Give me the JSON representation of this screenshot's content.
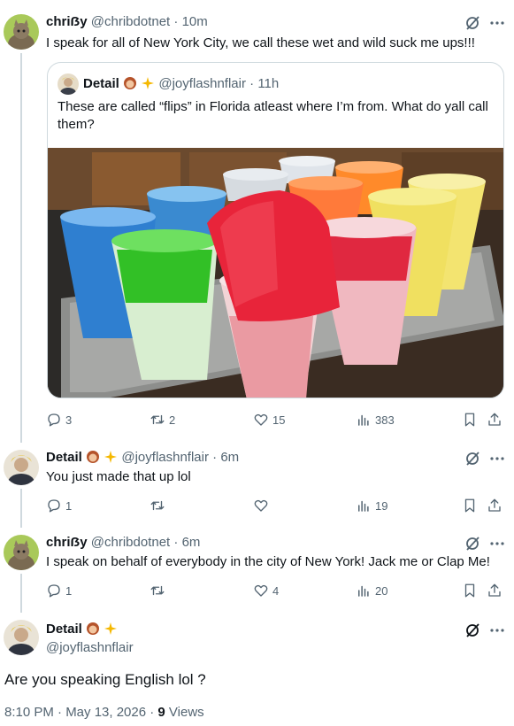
{
  "tweet1": {
    "name": "chriẞy",
    "handle": "@chribdotnet",
    "time": "10m",
    "text": "I speak for all of New York City, we call these wet and wild suck me ups!!!",
    "quote": {
      "name": "Detail",
      "handle": "@joyflashnflair",
      "time": "11h",
      "text": "These are called “flips” in Florida atleast where I’m from. What do yall call them?"
    },
    "replies": "3",
    "reposts": "2",
    "likes": "15",
    "views": "383"
  },
  "tweet2": {
    "name": "Detail",
    "handle": "@joyflashnflair",
    "time": "6m",
    "text": "You just made that up lol",
    "replies": "1",
    "reposts": "",
    "likes": "",
    "views": "19"
  },
  "tweet3": {
    "name": "chriẞy",
    "handle": "@chribdotnet",
    "time": "6m",
    "text": "I speak on behalf of everybody in the city of New York! Jack me or Clap Me!",
    "replies": "1",
    "reposts": "",
    "likes": "4",
    "views": "20"
  },
  "main": {
    "name": "Detail",
    "handle": "@joyflashnflair",
    "text": "Are you speaking English lol ?",
    "time": "8:10 PM · May 13, 2026 · ",
    "views_count": "9",
    "views_label": " Views"
  },
  "separator": "·",
  "colors": {
    "text": "#0f1419",
    "secondary": "#536471",
    "border": "#cfd9de"
  },
  "icons": [
    "reply-icon",
    "repost-icon",
    "like-icon",
    "views-icon",
    "bookmark-icon",
    "share-icon",
    "grok-icon",
    "more-icon"
  ]
}
